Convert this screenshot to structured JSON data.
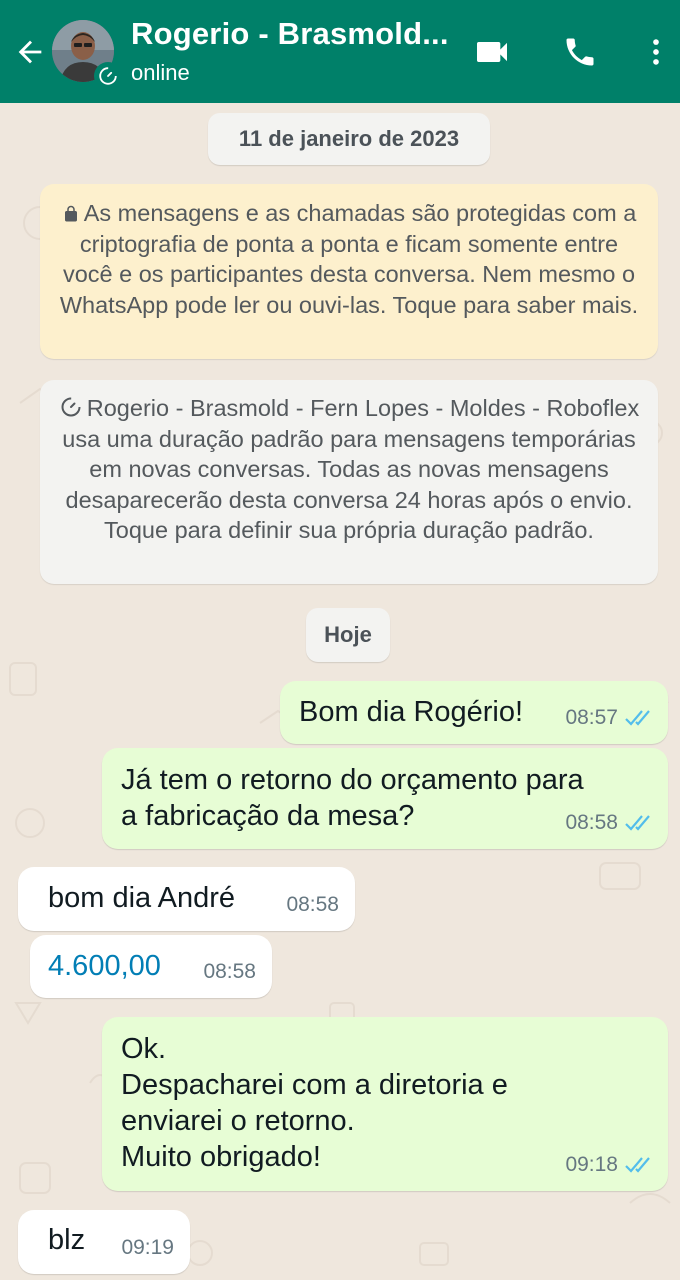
{
  "header": {
    "contact_name": "Rogerio - Brasmold...",
    "status": "online",
    "icons": [
      "back-arrow-icon",
      "avatar",
      "disappearing-timer-icon",
      "video-call-icon",
      "phone-icon",
      "more-vert-icon"
    ]
  },
  "chat": {
    "date_label": "11 de janeiro de 2023",
    "encryption_notice": "As mensagens e as chamadas são protegidas com a criptografia de ponta a ponta e ficam somente entre você e os participantes desta conversa. Nem mesmo o WhatsApp pode ler ou ouvi-las. Toque para saber mais.",
    "disappearing_notice": "Rogerio - Brasmold - Fern Lopes - Moldes - Roboflex usa uma duração padrão para mensagens temporárias em novas conversas. Todas as novas mensagens desaparecerão desta conversa 24 horas após o envio. Toque para definir sua própria duração padrão.",
    "today_label": "Hoje",
    "messages": [
      {
        "direction": "out",
        "text": "Bom dia Rogério!",
        "time": "08:57",
        "status": "read"
      },
      {
        "direction": "out",
        "text": "Já tem o retorno do orçamento para\na fabricação da mesa?",
        "time": "08:58",
        "status": "read"
      },
      {
        "direction": "in",
        "text": "bom dia André",
        "time": "08:58"
      },
      {
        "direction": "in",
        "text": "4.600,00",
        "time": "08:58"
      },
      {
        "direction": "out",
        "text": "Ok.\nDespacharei com a diretoria e\nenviarei o retorno.\nMuito obrigado!",
        "time": "09:18",
        "status": "read"
      },
      {
        "direction": "in",
        "text": "blz",
        "time": "09:19"
      }
    ]
  },
  "colors": {
    "header_bg": "#008069",
    "chat_bg": "#efe7dd",
    "outgoing_bubble": "#e7fdd5",
    "incoming_bubble": "#ffffff",
    "encryption_bg": "#fdf0cd",
    "read_ticks": "#53bdeb",
    "amount_link": "#027eb5"
  }
}
